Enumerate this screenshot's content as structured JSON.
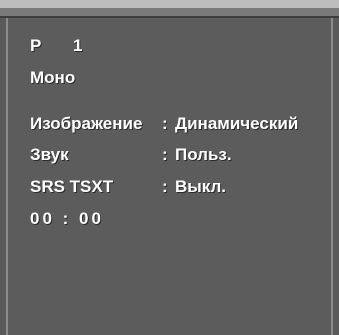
{
  "channel": {
    "prefix": "P",
    "number": "1"
  },
  "audio_mode": "Моно",
  "settings": [
    {
      "label": "Изображение",
      "separator": ":",
      "value": "Динамический"
    },
    {
      "label": "Звук",
      "separator": ":",
      "value": "Польз."
    },
    {
      "label": "SRS TSXT",
      "separator": ":",
      "value": "Выкл."
    }
  ],
  "clock": "00 : 00",
  "colors": {
    "background": "#5a5a5a",
    "text": "#ffffff",
    "top_bar": "#bdbdbd"
  }
}
